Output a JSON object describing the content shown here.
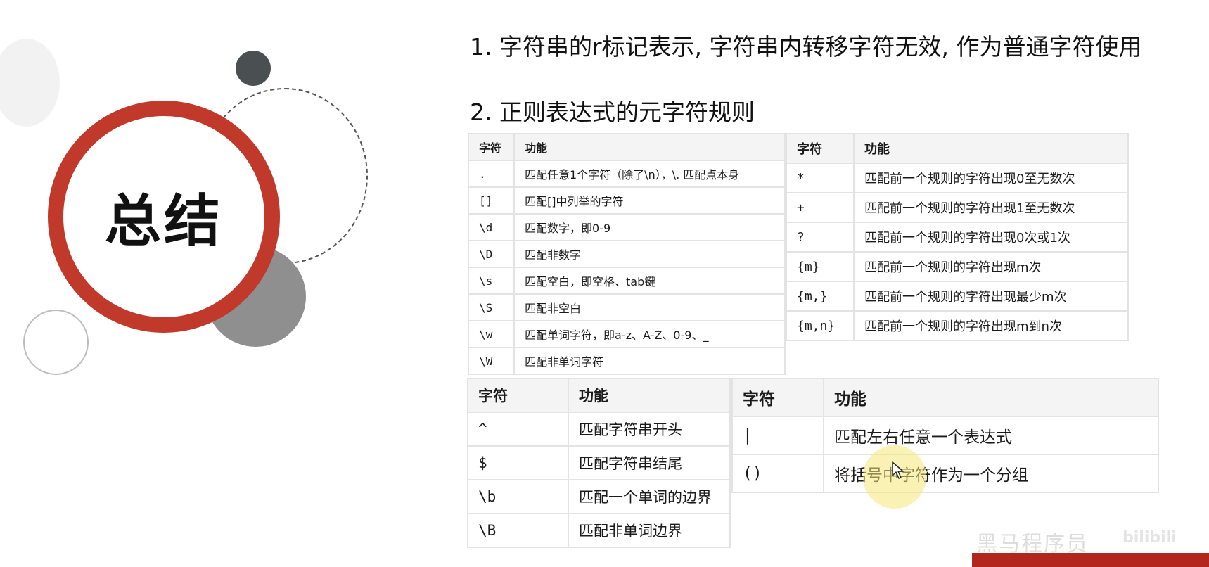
{
  "slide": {
    "title": "总结",
    "heading1": "1. 字符串的r标记表示, 字符串内转移字符无效, 作为普通字符使用",
    "heading2": "2. 正则表达式的元字符规则"
  },
  "table1": {
    "headers": [
      "字符",
      "功能"
    ],
    "rows": [
      [
        ".",
        "匹配任意1个字符（除了\\n），\\. 匹配点本身"
      ],
      [
        "[]",
        "匹配[]中列举的字符"
      ],
      [
        "\\d",
        "匹配数字，即0-9"
      ],
      [
        "\\D",
        "匹配非数字"
      ],
      [
        "\\s",
        "匹配空白，即空格、tab键"
      ],
      [
        "\\S",
        "匹配非空白"
      ],
      [
        "\\w",
        "匹配单词字符，即a-z、A-Z、0-9、_"
      ],
      [
        "\\W",
        "匹配非单词字符"
      ]
    ]
  },
  "table2": {
    "headers": [
      "字符",
      "功能"
    ],
    "rows": [
      [
        "*",
        "匹配前一个规则的字符出现0至无数次"
      ],
      [
        "+",
        "匹配前一个规则的字符出现1至无数次"
      ],
      [
        "?",
        "匹配前一个规则的字符出现0次或1次"
      ],
      [
        "{m}",
        "匹配前一个规则的字符出现m次"
      ],
      [
        "{m,}",
        "匹配前一个规则的字符出现最少m次"
      ],
      [
        "{m,n}",
        "匹配前一个规则的字符出现m到n次"
      ]
    ]
  },
  "table3": {
    "headers": [
      "字符",
      "功能"
    ],
    "rows": [
      [
        "^",
        "匹配字符串开头"
      ],
      [
        "$",
        "匹配字符串结尾"
      ],
      [
        "\\b",
        "匹配一个单词的边界"
      ],
      [
        "\\B",
        "匹配非单词边界"
      ]
    ]
  },
  "table4": {
    "headers": [
      "字符",
      "功能"
    ],
    "rows": [
      [
        "|",
        "匹配左右任意一个表达式"
      ],
      [
        "()",
        "将括号中字符作为一个分组"
      ]
    ]
  },
  "watermark": "黑马程序员",
  "logo": "bilibili",
  "colors": {
    "accent_red": "#c0392b",
    "dark_circle": "#4a4f52",
    "gray_circle": "#8f8f8f"
  }
}
